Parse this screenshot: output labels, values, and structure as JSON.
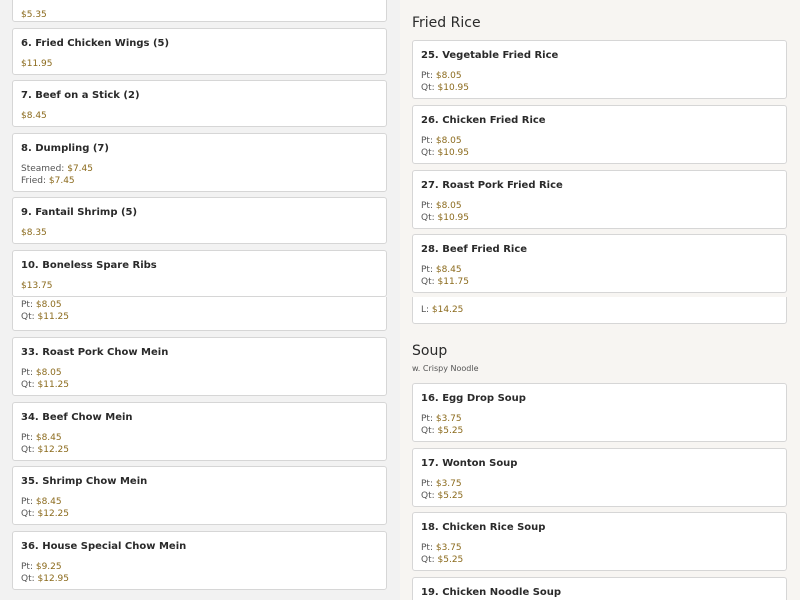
{
  "top_left": {
    "cards": [
      {
        "title": "",
        "prices": [
          {
            "label": "",
            "value": "$5.35"
          }
        ]
      },
      {
        "title": "6. Fried Chicken Wings (5)",
        "prices": [
          {
            "label": "",
            "value": "$11.95"
          }
        ]
      },
      {
        "title": "7. Beef on a Stick (2)",
        "prices": [
          {
            "label": "",
            "value": "$8.45"
          }
        ]
      },
      {
        "title": "8. Dumpling (7)",
        "prices": [
          {
            "label": "Steamed: ",
            "value": "$7.45"
          },
          {
            "label": "Fried: ",
            "value": "$7.45"
          }
        ]
      },
      {
        "title": "9. Fantail Shrimp (5)",
        "prices": [
          {
            "label": "",
            "value": "$8.35"
          }
        ]
      },
      {
        "title": "10. Boneless Spare Ribs",
        "prices": [
          {
            "label": "",
            "value": "$13.75"
          }
        ]
      }
    ]
  },
  "top_right": {
    "section_title": "Fried Rice",
    "cards": [
      {
        "title": "25. Vegetable Fried Rice",
        "prices": [
          {
            "label": "Pt: ",
            "value": "$8.05"
          },
          {
            "label": "Qt: ",
            "value": "$10.95"
          }
        ]
      },
      {
        "title": "26. Chicken Fried Rice",
        "prices": [
          {
            "label": "Pt: ",
            "value": "$8.05"
          },
          {
            "label": "Qt: ",
            "value": "$10.95"
          }
        ]
      },
      {
        "title": "27. Roast Pork Fried Rice",
        "prices": [
          {
            "label": "Pt: ",
            "value": "$8.05"
          },
          {
            "label": "Qt: ",
            "value": "$10.95"
          }
        ]
      },
      {
        "title": "28. Beef Fried Rice",
        "prices": [
          {
            "label": "Pt: ",
            "value": "$8.45"
          },
          {
            "label": "Qt: ",
            "value": "$11.75"
          }
        ]
      }
    ]
  },
  "bottom_left": {
    "cards": [
      {
        "title": "",
        "prices": [
          {
            "label": "Pt: ",
            "value": "$8.05"
          },
          {
            "label": "Qt: ",
            "value": "$11.25"
          }
        ]
      },
      {
        "title": "33. Roast Pork Chow Mein",
        "prices": [
          {
            "label": "Pt: ",
            "value": "$8.05"
          },
          {
            "label": "Qt: ",
            "value": "$11.25"
          }
        ]
      },
      {
        "title": "34. Beef Chow Mein",
        "prices": [
          {
            "label": "Pt: ",
            "value": "$8.45"
          },
          {
            "label": "Qt: ",
            "value": "$12.25"
          }
        ]
      },
      {
        "title": "35. Shrimp Chow Mein",
        "prices": [
          {
            "label": "Pt: ",
            "value": "$8.45"
          },
          {
            "label": "Qt: ",
            "value": "$12.25"
          }
        ]
      },
      {
        "title": "36. House Special Chow Mein",
        "prices": [
          {
            "label": "Pt: ",
            "value": "$9.25"
          },
          {
            "label": "Qt: ",
            "value": "$12.95"
          }
        ]
      }
    ]
  },
  "bottom_right": {
    "section_title": "Soup",
    "section_subtitle": "w. Crispy Noodle",
    "cards": [
      {
        "title": "",
        "prices": [
          {
            "label": "L: ",
            "value": "$14.25"
          }
        ]
      },
      {
        "title": "16. Egg Drop Soup",
        "prices": [
          {
            "label": "Pt: ",
            "value": "$3.75"
          },
          {
            "label": "Qt: ",
            "value": "$5.25"
          }
        ]
      },
      {
        "title": "17. Wonton Soup",
        "prices": [
          {
            "label": "Pt: ",
            "value": "$3.75"
          },
          {
            "label": "Qt: ",
            "value": "$5.25"
          }
        ]
      },
      {
        "title": "18. Chicken Rice Soup",
        "prices": [
          {
            "label": "Pt: ",
            "value": "$3.75"
          },
          {
            "label": "Qt: ",
            "value": "$5.25"
          }
        ]
      },
      {
        "title": "19. Chicken Noodle Soup",
        "prices": []
      }
    ]
  }
}
